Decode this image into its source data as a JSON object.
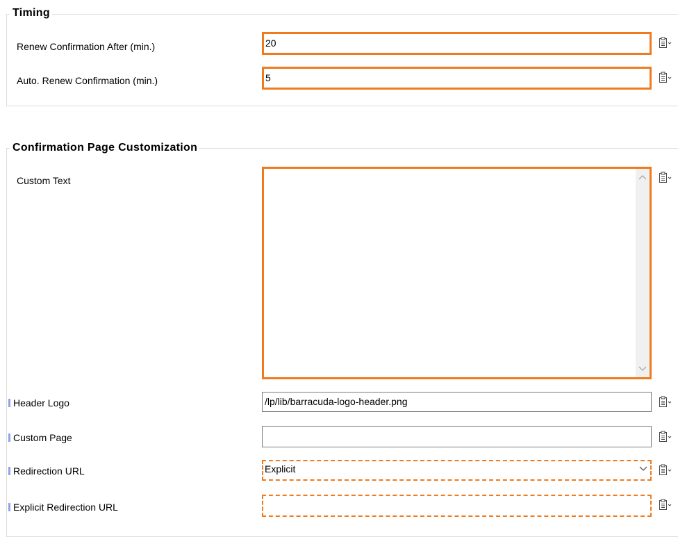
{
  "timing": {
    "title": "Timing",
    "renew_after": {
      "label": "Renew Confirmation After (min.)",
      "value": "20"
    },
    "auto_renew": {
      "label": "Auto. Renew Confirmation (min.)",
      "value": "5"
    }
  },
  "customization": {
    "title": "Confirmation Page Customization",
    "custom_text": {
      "label": "Custom Text",
      "value": ""
    },
    "header_logo": {
      "label": "Header Logo",
      "value": "/lp/lib/barracuda-logo-header.png"
    },
    "custom_page": {
      "label": "Custom Page",
      "value": ""
    },
    "redirection_url": {
      "label": "Redirection URL",
      "value": "Explicit"
    },
    "explicit_redirection_url": {
      "label": "Explicit Redirection URL",
      "value": ""
    }
  },
  "colors": {
    "accent_orange": "#f07a1e",
    "marker_blue": "#8fa4e8"
  },
  "icons": {
    "field_action": "clipboard-dropdown-icon",
    "scroll_up": "chevron-up-icon",
    "scroll_down": "chevron-down-icon",
    "combo": "chevron-down-icon"
  }
}
